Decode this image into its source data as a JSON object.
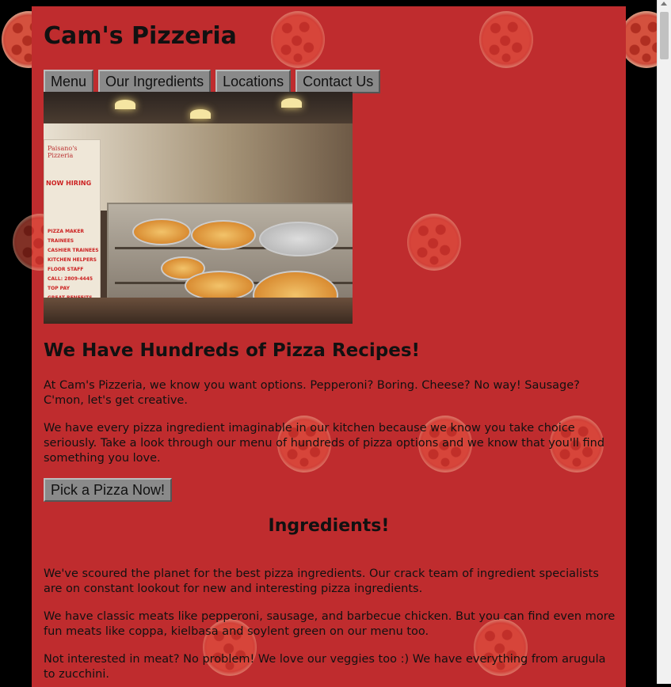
{
  "site": {
    "title": "Cam's Pizzeria"
  },
  "nav": {
    "items": [
      "Menu",
      "Our Ingredients",
      "Locations",
      "Contact Us"
    ]
  },
  "hero": {
    "image_alt": "",
    "banner_brand": "Paisano's Pizzeria",
    "banner_hiring": "NOW HIRING",
    "banner_list": [
      "PIZZA MAKER TRAINEES",
      "CASHIER TRAINEES",
      "KITCHEN HELPERS",
      "FLOOR STAFF",
      "CALL: 2809-4445",
      "TOP PAY",
      "GREAT BENEFITS"
    ]
  },
  "intro": {
    "heading": "We Have Hundreds of Pizza Recipes!",
    "para1": "At Cam's Pizzeria, we know you want options. Pepperoni? Boring. Cheese? No way! Sausage? C'mon, let's get creative.",
    "para2": "We have every pizza ingredient imaginable in our kitchen because we know you take choice seriously. Take a look through our menu of hundreds of pizza options and we know that you'll find something you love.",
    "cta_label": "Pick a Pizza Now!"
  },
  "ingredients": {
    "heading": "Ingredients!",
    "para1": "We've scoured the planet for the best pizza ingredients. Our crack team of ingredient specialists are on constant lookout for new and interesting pizza ingredients.",
    "para2": "We have classic meats like pepperoni, sausage, and barbecue chicken. But you can find even more fun meats like coppa, kielbasa and soylent green on our menu too.",
    "para3": "Not interested in meat? No problem! We love our veggies too :) We have everything from arugula to zucchini."
  },
  "colors": {
    "page_bg": "#bf2c2e",
    "outer_bg": "#000000",
    "button_bg": "#8a8a8a"
  }
}
